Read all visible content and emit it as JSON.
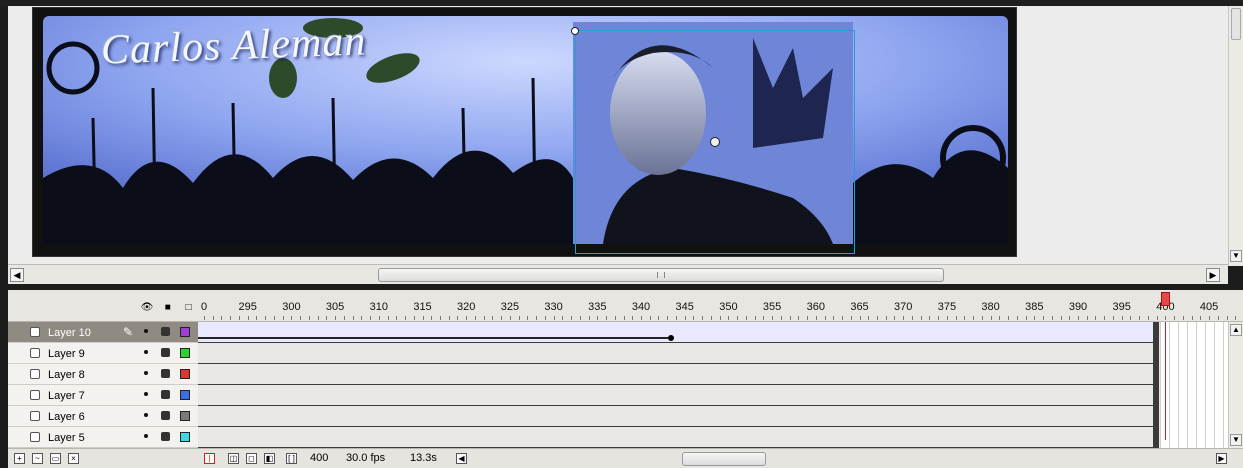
{
  "banner": {
    "title": "Carlos Aleman"
  },
  "timeline": {
    "ruler_labels": [
      "0",
      "295",
      "300",
      "305",
      "310",
      "315",
      "320",
      "325",
      "330",
      "335",
      "340",
      "345",
      "350",
      "355",
      "360",
      "365",
      "370",
      "375",
      "380",
      "385",
      "390",
      "395",
      "400",
      "405"
    ],
    "header_icons": [
      "eye-icon",
      "lock-icon",
      "outline-icon"
    ],
    "layers": [
      {
        "name": "Layer 10",
        "color": "#9b3fd6",
        "active": true
      },
      {
        "name": "Layer 9",
        "color": "#2fd12f",
        "active": false
      },
      {
        "name": "Layer 8",
        "color": "#e03434",
        "active": false
      },
      {
        "name": "Layer 7",
        "color": "#3a6ee6",
        "active": false
      },
      {
        "name": "Layer 6",
        "color": "#7a7a7a",
        "active": false
      },
      {
        "name": "Layer 5",
        "color": "#3fd6e6",
        "active": false
      }
    ],
    "status": {
      "current_frame": "400",
      "frame_rate": "30.0 fps",
      "elapsed": "13.3s"
    }
  },
  "colors": {
    "accent_selection": "#2b9bd8",
    "playhead": "#e24a4a"
  }
}
